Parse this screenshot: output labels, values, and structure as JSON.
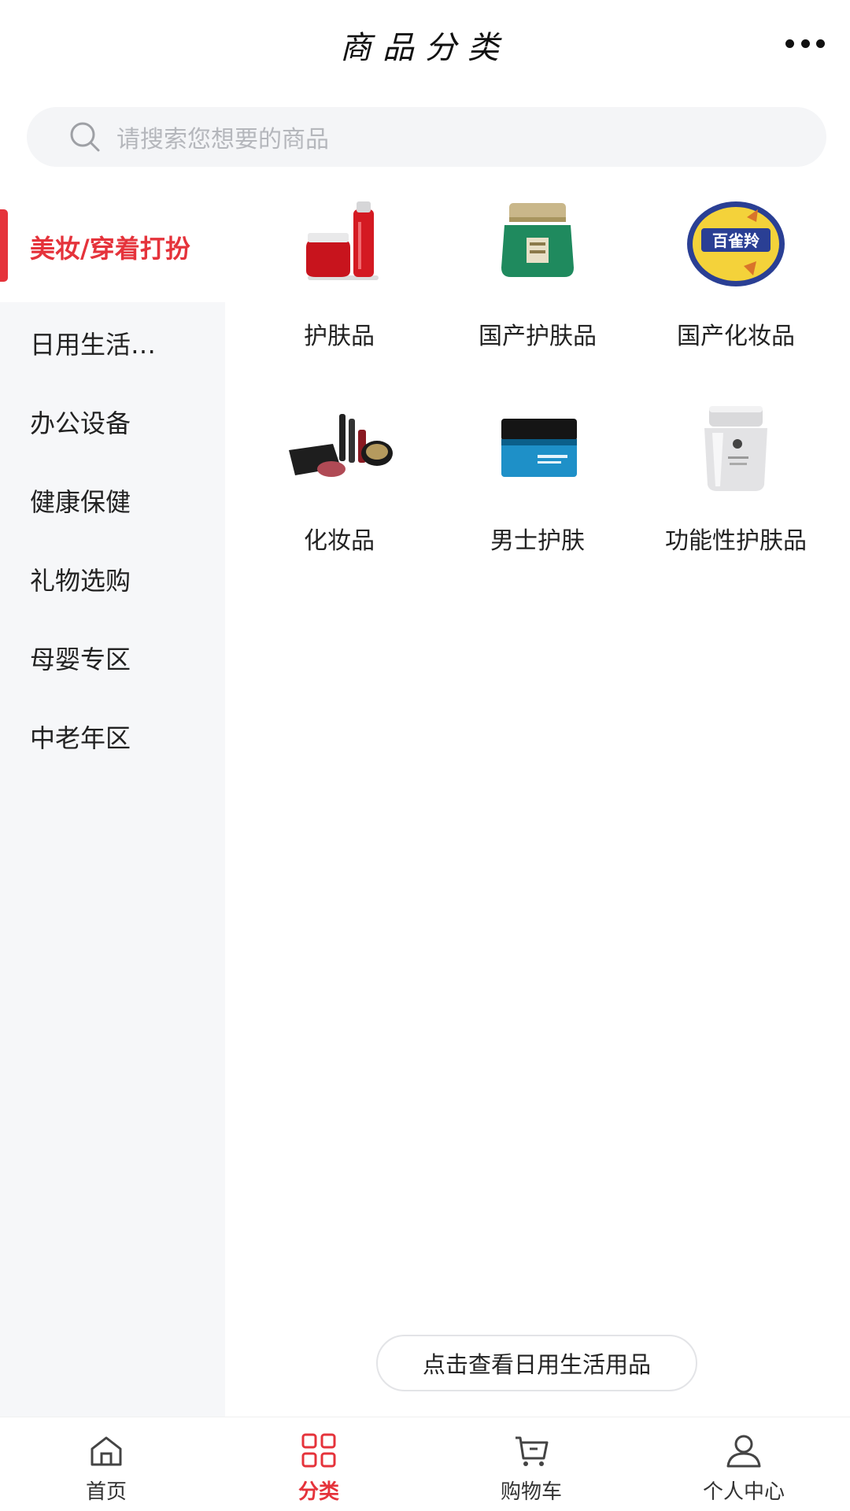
{
  "header": {
    "title": "商品分类",
    "more_icon": "more-icon"
  },
  "search": {
    "placeholder": "请搜索您想要的商品",
    "icon": "search-icon"
  },
  "sidebar": {
    "items": [
      {
        "label": "美妆/穿着打扮",
        "active": true
      },
      {
        "label": "日用生活…"
      },
      {
        "label": "办公设备"
      },
      {
        "label": "健康保健"
      },
      {
        "label": "礼物选购"
      },
      {
        "label": "母婴专区"
      },
      {
        "label": "中老年区"
      }
    ]
  },
  "subcategories": [
    {
      "label": "护肤品",
      "icon": "skincare-product-image"
    },
    {
      "label": "国产护肤品",
      "icon": "domestic-skincare-jar-image"
    },
    {
      "label": "国产化妆品",
      "icon": "domestic-cosmetics-logo-image"
    },
    {
      "label": "化妆品",
      "icon": "makeup-set-image"
    },
    {
      "label": "男士护肤",
      "icon": "mens-skincare-jar-image"
    },
    {
      "label": "功能性护肤品",
      "icon": "functional-skincare-jar-image"
    }
  ],
  "next_category_button": "点击查看日用生活用品",
  "tabbar": {
    "tabs": [
      {
        "label": "首页",
        "icon": "home-icon"
      },
      {
        "label": "分类",
        "icon": "category-grid-icon",
        "active": true
      },
      {
        "label": "购物车",
        "icon": "cart-icon"
      },
      {
        "label": "个人中心",
        "icon": "user-icon"
      }
    ]
  },
  "colors": {
    "accent": "#e5333b",
    "sidebar_bg": "#f6f7f9",
    "search_bg": "#f4f5f7"
  }
}
